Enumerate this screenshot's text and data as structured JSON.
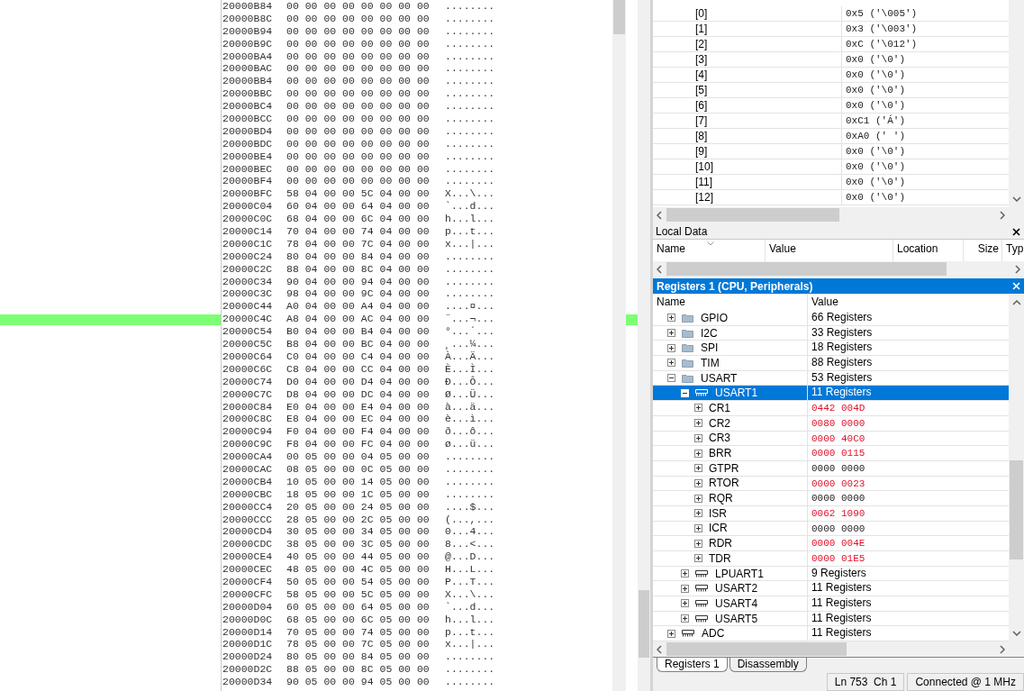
{
  "memory": {
    "rows": [
      {
        "address": "20000B84",
        "bytes": "00 00 00 00 00 00 00 00",
        "ascii": "........"
      },
      {
        "address": "20000B8C",
        "bytes": "00 00 00 00 00 00 00 00",
        "ascii": "........"
      },
      {
        "address": "20000B94",
        "bytes": "00 00 00 00 00 00 00 00",
        "ascii": "........"
      },
      {
        "address": "20000B9C",
        "bytes": "00 00 00 00 00 00 00 00",
        "ascii": "........"
      },
      {
        "address": "20000BA4",
        "bytes": "00 00 00 00 00 00 00 00",
        "ascii": "........"
      },
      {
        "address": "20000BAC",
        "bytes": "00 00 00 00 00 00 00 00",
        "ascii": "........"
      },
      {
        "address": "20000BB4",
        "bytes": "00 00 00 00 00 00 00 00",
        "ascii": "........"
      },
      {
        "address": "20000BBC",
        "bytes": "00 00 00 00 00 00 00 00",
        "ascii": "........"
      },
      {
        "address": "20000BC4",
        "bytes": "00 00 00 00 00 00 00 00",
        "ascii": "........"
      },
      {
        "address": "20000BCC",
        "bytes": "00 00 00 00 00 00 00 00",
        "ascii": "........"
      },
      {
        "address": "20000BD4",
        "bytes": "00 00 00 00 00 00 00 00",
        "ascii": "........"
      },
      {
        "address": "20000BDC",
        "bytes": "00 00 00 00 00 00 00 00",
        "ascii": "........"
      },
      {
        "address": "20000BE4",
        "bytes": "00 00 00 00 00 00 00 00",
        "ascii": "........"
      },
      {
        "address": "20000BEC",
        "bytes": "00 00 00 00 00 00 00 00",
        "ascii": "........"
      },
      {
        "address": "20000BF4",
        "bytes": "00 00 00 00 00 00 00 00",
        "ascii": "........"
      },
      {
        "address": "20000BFC",
        "bytes": "58 04 00 00 5C 04 00 00",
        "ascii": "X...\\..."
      },
      {
        "address": "20000C04",
        "bytes": "60 04 00 00 64 04 00 00",
        "ascii": "`...d..."
      },
      {
        "address": "20000C0C",
        "bytes": "68 04 00 00 6C 04 00 00",
        "ascii": "h...l..."
      },
      {
        "address": "20000C14",
        "bytes": "70 04 00 00 74 04 00 00",
        "ascii": "p...t..."
      },
      {
        "address": "20000C1C",
        "bytes": "78 04 00 00 7C 04 00 00",
        "ascii": "x...|..."
      },
      {
        "address": "20000C24",
        "bytes": "80 04 00 00 84 04 00 00",
        "ascii": "........"
      },
      {
        "address": "20000C2C",
        "bytes": "88 04 00 00 8C 04 00 00",
        "ascii": "........"
      },
      {
        "address": "20000C34",
        "bytes": "90 04 00 00 94 04 00 00",
        "ascii": "........"
      },
      {
        "address": "20000C3C",
        "bytes": "98 04 00 00 9C 04 00 00",
        "ascii": "........"
      },
      {
        "address": "20000C44",
        "bytes": "A0 04 00 00 A4 04 00 00",
        "ascii": "....¤..."
      },
      {
        "address": "20000C4C",
        "bytes": "A8 04 00 00 AC 04 00 00",
        "ascii": "¨...¬..."
      },
      {
        "address": "20000C54",
        "bytes": "B0 04 00 00 B4 04 00 00",
        "ascii": "°...´..."
      },
      {
        "address": "20000C5C",
        "bytes": "B8 04 00 00 BC 04 00 00",
        "ascii": "¸...¼..."
      },
      {
        "address": "20000C64",
        "bytes": "C0 04 00 00 C4 04 00 00",
        "ascii": "À...Ä..."
      },
      {
        "address": "20000C6C",
        "bytes": "C8 04 00 00 CC 04 00 00",
        "ascii": "È...Ì..."
      },
      {
        "address": "20000C74",
        "bytes": "D0 04 00 00 D4 04 00 00",
        "ascii": "Ð...Ô..."
      },
      {
        "address": "20000C7C",
        "bytes": "D8 04 00 00 DC 04 00 00",
        "ascii": "Ø...Ü..."
      },
      {
        "address": "20000C84",
        "bytes": "E0 04 00 00 E4 04 00 00",
        "ascii": "à...ä..."
      },
      {
        "address": "20000C8C",
        "bytes": "E8 04 00 00 EC 04 00 00",
        "ascii": "è...ì..."
      },
      {
        "address": "20000C94",
        "bytes": "F0 04 00 00 F4 04 00 00",
        "ascii": "ð...ô..."
      },
      {
        "address": "20000C9C",
        "bytes": "F8 04 00 00 FC 04 00 00",
        "ascii": "ø...ü..."
      },
      {
        "address": "20000CA4",
        "bytes": "00 05 00 00 04 05 00 00",
        "ascii": "........"
      },
      {
        "address": "20000CAC",
        "bytes": "08 05 00 00 0C 05 00 00",
        "ascii": "........"
      },
      {
        "address": "20000CB4",
        "bytes": "10 05 00 00 14 05 00 00",
        "ascii": "........"
      },
      {
        "address": "20000CBC",
        "bytes": "18 05 00 00 1C 05 00 00",
        "ascii": "........"
      },
      {
        "address": "20000CC4",
        "bytes": "20 05 00 00 24 05 00 00",
        "ascii": "....$..."
      },
      {
        "address": "20000CCC",
        "bytes": "28 05 00 00 2C 05 00 00",
        "ascii": "(...,..."
      },
      {
        "address": "20000CD4",
        "bytes": "30 05 00 00 34 05 00 00",
        "ascii": "0...4..."
      },
      {
        "address": "20000CDC",
        "bytes": "38 05 00 00 3C 05 00 00",
        "ascii": "8...<..."
      },
      {
        "address": "20000CE4",
        "bytes": "40 05 00 00 44 05 00 00",
        "ascii": "@...D..."
      },
      {
        "address": "20000CEC",
        "bytes": "48 05 00 00 4C 05 00 00",
        "ascii": "H...L..."
      },
      {
        "address": "20000CF4",
        "bytes": "50 05 00 00 54 05 00 00",
        "ascii": "P...T..."
      },
      {
        "address": "20000CFC",
        "bytes": "58 05 00 00 5C 05 00 00",
        "ascii": "X...\\..."
      },
      {
        "address": "20000D04",
        "bytes": "60 05 00 00 64 05 00 00",
        "ascii": "`...d..."
      },
      {
        "address": "20000D0C",
        "bytes": "68 05 00 00 6C 05 00 00",
        "ascii": "h...l..."
      },
      {
        "address": "20000D14",
        "bytes": "70 05 00 00 74 05 00 00",
        "ascii": "p...t..."
      },
      {
        "address": "20000D1C",
        "bytes": "78 05 00 00 7C 05 00 00",
        "ascii": "x...|..."
      },
      {
        "address": "20000D24",
        "bytes": "80 05 00 00 84 05 00 00",
        "ascii": "........"
      },
      {
        "address": "20000D2C",
        "bytes": "88 05 00 00 8C 05 00 00",
        "ascii": "........"
      },
      {
        "address": "20000D34",
        "bytes": "90 05 00 00 94 05 00 00",
        "ascii": "........"
      }
    ]
  },
  "watch": {
    "rows": [
      {
        "name": "[0]",
        "value": "0x5 ('\\005')"
      },
      {
        "name": "[1]",
        "value": "0x3 ('\\003')"
      },
      {
        "name": "[2]",
        "value": "0xC ('\\012')"
      },
      {
        "name": "[3]",
        "value": "0x0 ('\\0')"
      },
      {
        "name": "[4]",
        "value": "0x0 ('\\0')"
      },
      {
        "name": "[5]",
        "value": "0x0 ('\\0')"
      },
      {
        "name": "[6]",
        "value": "0x0 ('\\0')"
      },
      {
        "name": "[7]",
        "value": "0xC1 ('Á')"
      },
      {
        "name": "[8]",
        "value": "0xA0 (' ')"
      },
      {
        "name": "[9]",
        "value": "0x0 ('\\0')"
      },
      {
        "name": "[10]",
        "value": "0x0 ('\\0')"
      },
      {
        "name": "[11]",
        "value": "0x0 ('\\0')"
      },
      {
        "name": "[12]",
        "value": "0x0 ('\\0')"
      }
    ]
  },
  "local_data": {
    "title": "Local Data",
    "columns": [
      "Name",
      "Value",
      "Location",
      "Size",
      "Typ"
    ]
  },
  "registers": {
    "title": "Registers 1 (CPU, Peripherals)",
    "columns": [
      "Name",
      "Value"
    ],
    "rows": [
      {
        "name": "GPIO",
        "value": "66 Registers",
        "kind": "group",
        "expanded": false,
        "selected": false
      },
      {
        "name": "I2C",
        "value": "33 Registers",
        "kind": "group",
        "expanded": false,
        "selected": false
      },
      {
        "name": "SPI",
        "value": "18 Registers",
        "kind": "group",
        "expanded": false,
        "selected": false
      },
      {
        "name": "TIM",
        "value": "88 Registers",
        "kind": "group",
        "expanded": false,
        "selected": false
      },
      {
        "name": "USART",
        "value": "53 Registers",
        "kind": "group",
        "expanded": true,
        "selected": false,
        "children": [
          {
            "name": "USART1",
            "value": "11 Registers",
            "kind": "peripheral",
            "expanded": true,
            "selected": true,
            "children": [
              {
                "name": "CR1",
                "value": "0442 004D",
                "kind": "register",
                "expanded": false,
                "selected": false,
                "changed": true
              },
              {
                "name": "CR2",
                "value": "0080 0000",
                "kind": "register",
                "expanded": false,
                "selected": false,
                "changed": true
              },
              {
                "name": "CR3",
                "value": "0000 40C0",
                "kind": "register",
                "expanded": false,
                "selected": false,
                "changed": true
              },
              {
                "name": "BRR",
                "value": "0000 0115",
                "kind": "register",
                "expanded": false,
                "selected": false,
                "changed": true
              },
              {
                "name": "GTPR",
                "value": "0000 0000",
                "kind": "register",
                "expanded": false,
                "selected": false,
                "changed": false
              },
              {
                "name": "RTOR",
                "value": "0000 0023",
                "kind": "register",
                "expanded": false,
                "selected": false,
                "changed": true
              },
              {
                "name": "RQR",
                "value": "0000 0000",
                "kind": "register",
                "expanded": false,
                "selected": false,
                "changed": false
              },
              {
                "name": "ISR",
                "value": "0062 1090",
                "kind": "register",
                "expanded": false,
                "selected": false,
                "changed": true
              },
              {
                "name": "ICR",
                "value": "0000 0000",
                "kind": "register",
                "expanded": false,
                "selected": false,
                "changed": false
              },
              {
                "name": "RDR",
                "value": "0000 004E",
                "kind": "register",
                "expanded": false,
                "selected": false,
                "changed": true
              },
              {
                "name": "TDR",
                "value": "0000 01E5",
                "kind": "register",
                "expanded": false,
                "selected": false,
                "changed": true
              }
            ]
          },
          {
            "name": "LPUART1",
            "value": "9 Registers",
            "kind": "peripheral",
            "expanded": false,
            "selected": false
          },
          {
            "name": "USART2",
            "value": "11 Registers",
            "kind": "peripheral",
            "expanded": false,
            "selected": false
          },
          {
            "name": "USART4",
            "value": "11 Registers",
            "kind": "peripheral",
            "expanded": false,
            "selected": false
          },
          {
            "name": "USART5",
            "value": "11 Registers",
            "kind": "peripheral",
            "expanded": false,
            "selected": false
          }
        ]
      },
      {
        "name": "ADC",
        "value": "11 Registers",
        "kind": "peripheral",
        "expanded": false,
        "selected": false
      }
    ]
  },
  "tabs": [
    {
      "label": "Registers 1",
      "selected": true
    },
    {
      "label": "Disassembly",
      "selected": false
    }
  ],
  "status_bar": {
    "position": "Ln 753  Ch 1",
    "connection": "Connected @ 1 MHz"
  }
}
